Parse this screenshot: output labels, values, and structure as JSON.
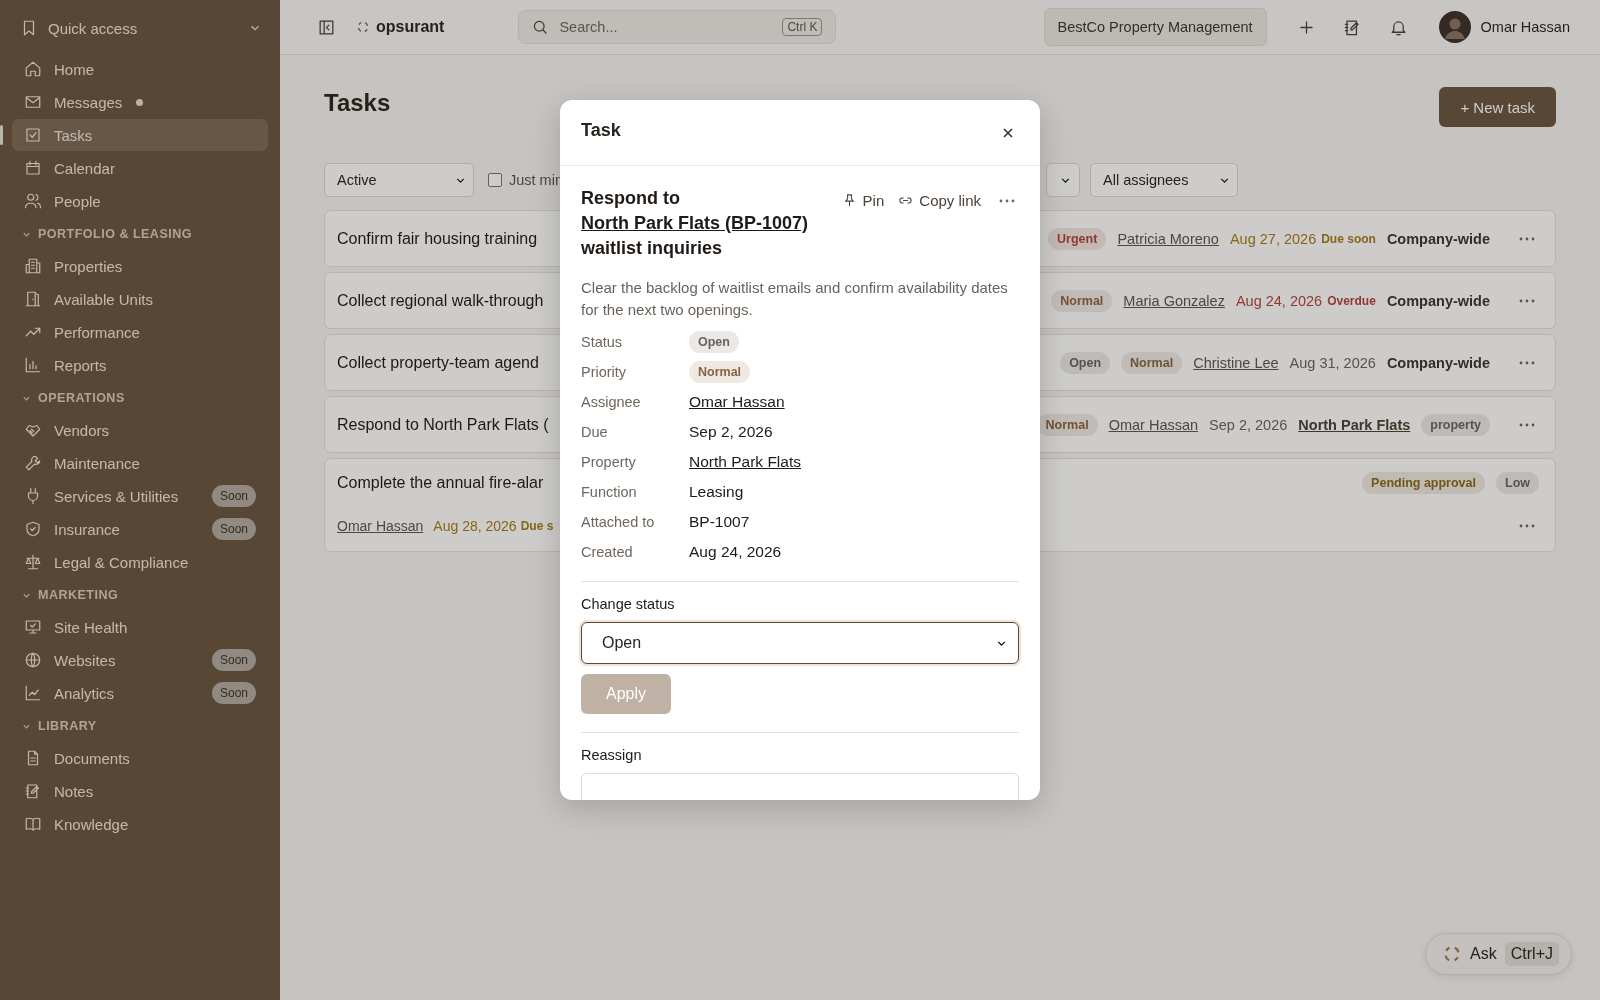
{
  "sidebar": {
    "quick_access": {
      "label": "Quick access",
      "expanded": true,
      "items": [
        {
          "label": "Home",
          "selected": false,
          "unread": false
        },
        {
          "label": "Messages",
          "selected": false,
          "unread": true
        },
        {
          "label": "Tasks",
          "selected": true,
          "unread": false
        },
        {
          "label": "Calendar",
          "selected": false,
          "unread": false
        },
        {
          "label": "People",
          "selected": false,
          "unread": false
        }
      ]
    },
    "sections": [
      {
        "label": "PORTFOLIO & LEASING",
        "expanded": true,
        "items": [
          {
            "label": "Properties",
            "selected": false
          },
          {
            "label": "Available Units",
            "selected": false
          },
          {
            "label": "Performance",
            "selected": false
          },
          {
            "label": "Reports",
            "selected": false
          }
        ]
      },
      {
        "label": "OPERATIONS",
        "expanded": true,
        "items": [
          {
            "label": "Vendors",
            "selected": false
          },
          {
            "label": "Maintenance",
            "selected": false
          },
          {
            "label": "Services & Utilities",
            "selected": false,
            "badge": "Soon"
          },
          {
            "label": "Insurance",
            "selected": false,
            "badge": "Soon"
          },
          {
            "label": "Legal & Compliance",
            "selected": false
          }
        ]
      },
      {
        "label": "MARKETING",
        "expanded": true,
        "items": [
          {
            "label": "Site Health",
            "selected": false
          },
          {
            "label": "Websites",
            "selected": false,
            "badge": "Soon"
          },
          {
            "label": "Analytics",
            "selected": false,
            "badge": "Soon"
          }
        ]
      },
      {
        "label": "LIBRARY",
        "expanded": true,
        "items": [
          {
            "label": "Documents",
            "selected": false
          },
          {
            "label": "Notes",
            "selected": false
          },
          {
            "label": "Knowledge",
            "selected": false
          }
        ]
      }
    ]
  },
  "topbar": {
    "brand": "opsurant",
    "search": {
      "placeholder": "Search...",
      "shortcut": "Ctrl K"
    },
    "organization": "BestCo Property Management",
    "user": "Omar Hassan"
  },
  "page": {
    "title": "Tasks",
    "new_button": "+ New task",
    "filters": [
      {
        "kind": "select",
        "value": "Active"
      },
      {
        "kind": "checkbox",
        "label": "Just min",
        "checked": false
      },
      {
        "kind": "select_hidden"
      },
      {
        "kind": "select",
        "value": "All assignees"
      }
    ],
    "tasks": [
      {
        "title": "Confirm fair housing training",
        "meta": [
          {
            "kind": "pill",
            "color": "#8f3a31",
            "text": "Urgent"
          },
          {
            "kind": "person",
            "text": "Patricia Moreno"
          },
          {
            "kind": "date",
            "color": "#886419",
            "text": "Aug 27, 2026"
          },
          {
            "kind": "flag",
            "color": "#886419",
            "text": "Due soon"
          },
          {
            "kind": "scope",
            "text": "Company-wide"
          }
        ]
      },
      {
        "title": "Collect regional walk-through",
        "meta": [
          {
            "kind": "pill",
            "color": "#725335",
            "text": "Normal"
          },
          {
            "kind": "person",
            "text": "Maria Gonzalez"
          },
          {
            "kind": "date",
            "color": "#913831",
            "text": "Aug 24, 2026"
          },
          {
            "kind": "flag",
            "color": "#913831",
            "text": "Overdue"
          },
          {
            "kind": "scope",
            "text": "Company-wide"
          }
        ]
      },
      {
        "title": "Collect property-team agend",
        "meta": [
          {
            "kind": "pill",
            "color": "#59514a",
            "text": "Open"
          },
          {
            "kind": "pill",
            "color": "#725335",
            "text": "Normal"
          },
          {
            "kind": "person",
            "text": "Christine Lee"
          },
          {
            "kind": "date",
            "color": "#59514a",
            "text": "Aug 31, 2026"
          },
          {
            "kind": "scope",
            "text": "Company-wide"
          }
        ]
      },
      {
        "title": "Respond to North Park Flats (",
        "meta": [
          {
            "kind": "pill",
            "color": "#725335",
            "text": "Normal"
          },
          {
            "kind": "person",
            "text": "Omar Hassan"
          },
          {
            "kind": "date",
            "color": "#59514a",
            "text": "Sep 2, 2026"
          },
          {
            "kind": "property",
            "text": "North Park Flats"
          },
          {
            "kind": "pill",
            "color": "#59514a",
            "text": "property"
          }
        ]
      },
      {
        "title": "Complete the annual fire-alar",
        "meta": [
          {
            "kind": "pill",
            "color": "#6f561a",
            "text": "Pending approval"
          },
          {
            "kind": "pill",
            "color": "#59514a",
            "text": "Low"
          }
        ],
        "sub": [
          {
            "kind": "person",
            "text": "Omar Hassan"
          },
          {
            "kind": "date",
            "color": "#886419",
            "text": "Aug 28, 2026"
          },
          {
            "kind": "flag",
            "color": "#886419",
            "text": "Due s"
          }
        ]
      }
    ]
  },
  "ask": {
    "label": "Ask",
    "shortcut": "Ctrl+J"
  },
  "modal": {
    "title": "Task",
    "heading": {
      "before": "Respond to",
      "link": "North Park Flats (BP-1007)",
      "after": "waitlist inquiries"
    },
    "actions": [
      {
        "kind": "pin",
        "label": "Pin"
      },
      {
        "kind": "link",
        "label": "Copy link"
      }
    ],
    "description": "Clear the backlog of waitlist emails and confirm availability dates for the next two openings.",
    "fields": [
      {
        "label": "Status",
        "kind": "pill",
        "color": "#6a625a",
        "value": "Open"
      },
      {
        "label": "Priority",
        "kind": "pill",
        "color": "#8a6440",
        "value": "Normal"
      },
      {
        "label": "Assignee",
        "kind": "link",
        "value": "Omar Hassan"
      },
      {
        "label": "Due",
        "kind": "text",
        "value": "Sep 2, 2026"
      },
      {
        "label": "Property",
        "kind": "link",
        "value": "North Park Flats"
      },
      {
        "label": "Function",
        "kind": "text",
        "value": "Leasing"
      },
      {
        "label": "Attached to",
        "kind": "text",
        "value": "BP-1007"
      },
      {
        "label": "Created",
        "kind": "text",
        "value": "Aug 24, 2026"
      }
    ],
    "change_status": {
      "label": "Change status",
      "value": "Open",
      "apply": "Apply",
      "apply_disabled": true
    },
    "reassign": {
      "label": "Reassign"
    }
  }
}
